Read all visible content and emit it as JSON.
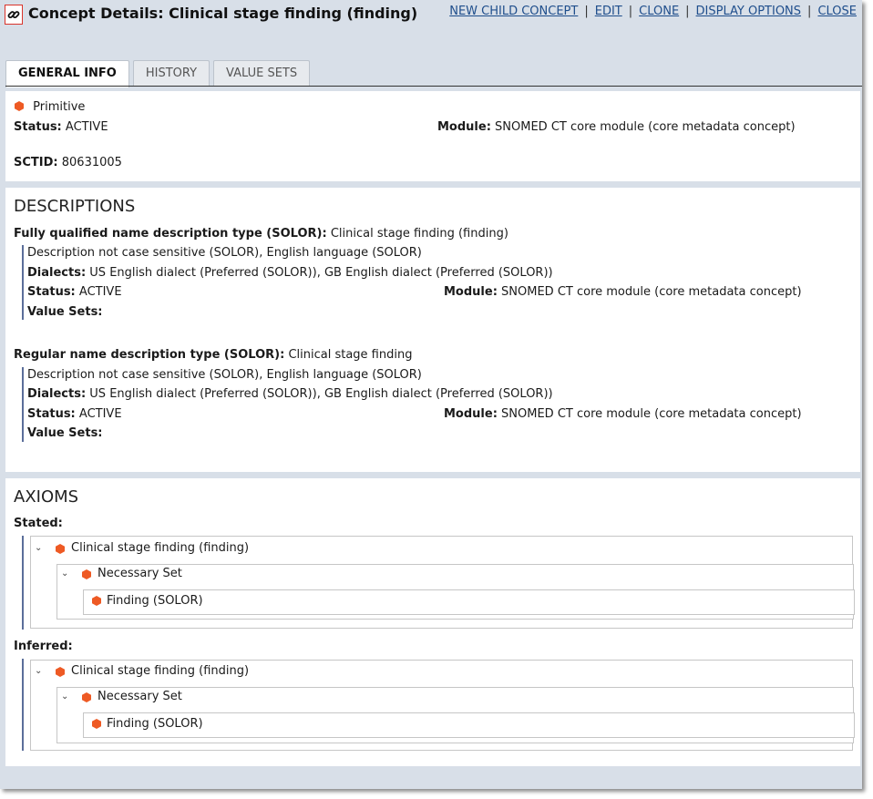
{
  "header": {
    "title": "Concept Details: Clinical stage finding (finding)",
    "actions": [
      "NEW CHILD CONCEPT",
      "EDIT",
      "CLONE",
      "DISPLAY OPTIONS",
      "CLOSE"
    ],
    "separator": "|"
  },
  "tabs": [
    "GENERAL INFO",
    "HISTORY",
    "VALUE SETS"
  ],
  "general": {
    "definition": "Primitive",
    "status_label": "Status:",
    "status_value": "ACTIVE",
    "module_label": "Module:",
    "module_value": "SNOMED CT core module (core metadata concept)",
    "sctid_label": "SCTID:",
    "sctid_value": "80631005"
  },
  "descriptions": {
    "title": "DESCRIPTIONS",
    "items": [
      {
        "type_label": "Fully qualified name description type (SOLOR):",
        "term": "Clinical stage finding (finding)",
        "case_lang": "Description not case sensitive (SOLOR), English language (SOLOR)",
        "dialects_label": "Dialects:",
        "dialects_value": "US English dialect (Preferred (SOLOR)), GB English dialect (Preferred (SOLOR))",
        "status_label": "Status:",
        "status_value": "ACTIVE",
        "module_label": "Module:",
        "module_value": "SNOMED CT core module (core metadata concept)",
        "valuesets_label": "Value Sets:"
      },
      {
        "type_label": "Regular name description type (SOLOR):",
        "term": "Clinical stage finding",
        "case_lang": "Description not case sensitive (SOLOR), English language (SOLOR)",
        "dialects_label": "Dialects:",
        "dialects_value": "US English dialect (Preferred (SOLOR)), GB English dialect (Preferred (SOLOR))",
        "status_label": "Status:",
        "status_value": "ACTIVE",
        "module_label": "Module:",
        "module_value": "SNOMED CT core module (core metadata concept)",
        "valuesets_label": "Value Sets:"
      }
    ]
  },
  "axioms": {
    "title": "AXIOMS",
    "stated": {
      "label": "Stated:",
      "root": "Clinical stage finding (finding)",
      "set": "Necessary Set",
      "leaf": "Finding (SOLOR)"
    },
    "inferred": {
      "label": "Inferred:",
      "root": "Clinical stage finding (finding)",
      "set": "Necessary Set",
      "leaf": "Finding (SOLOR)"
    }
  },
  "colors": {
    "concept_icon": "#ee5a24",
    "link": "#1f4e8c",
    "accent_bar": "#5b6e9a",
    "link_button_border": "#d9342b"
  },
  "icons": {
    "link_button": "link-icon",
    "concept": "concept-hexagon-icon",
    "expand": "chevron-down-icon"
  }
}
